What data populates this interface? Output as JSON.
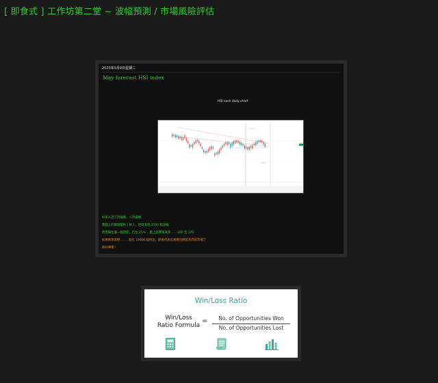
{
  "page": {
    "title": "[ 即食式 ] 工作坊第二堂 ~ 波幅預測 / 市場風險評估"
  },
  "post": {
    "date": "2023年5月9日星期二",
    "heading": "May forecast HSI index",
    "chart_caption": "HSI cash daily chart",
    "lines": [
      "好多人話５月會跌，６月會穩",
      "畫面上的兩個藍色 [ 框 ] ，佢既高低 2500 點波幅",
      "而黑線左邊一個週期，行左 25% ，藍上底畫落既係 ......200 至 170",
      "如果真係去晒 ........就在 19000 點附近，即係代表在真實已經是方向的市場了",
      "係好事嚟 !"
    ],
    "colors": {
      "heading": "#2ecc2e",
      "accent_orange": "#e08a1e",
      "candle_up": "#26a69a",
      "candle_down": "#ef5350"
    }
  },
  "card": {
    "title": "Win/Loss Ratio",
    "lhs_line1": "Win/Loss",
    "lhs_line2": "Ratio Formula",
    "equals": "=",
    "numerator": "No. of Opportunities Won",
    "denominator": "No. of Opportunities Lost",
    "icons": [
      "calculator-icon",
      "document-icon",
      "bar-chart-icon"
    ],
    "accent": "#3aa79a"
  }
}
